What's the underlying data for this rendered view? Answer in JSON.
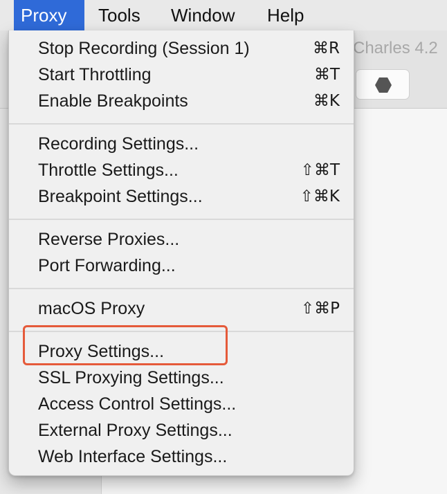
{
  "menubar": {
    "items": [
      {
        "label": "Proxy",
        "active": true
      },
      {
        "label": "Tools",
        "active": false
      },
      {
        "label": "Window",
        "active": false
      },
      {
        "label": "Help",
        "active": false
      }
    ]
  },
  "window": {
    "title": "Charles 4.2",
    "toolbar_icon": "stop-hexagon-icon"
  },
  "menu": {
    "groups": [
      [
        {
          "label": "Stop Recording (Session 1)",
          "shortcut": "⌘R"
        },
        {
          "label": "Start Throttling",
          "shortcut": "⌘T"
        },
        {
          "label": "Enable Breakpoints",
          "shortcut": "⌘K"
        }
      ],
      [
        {
          "label": "Recording Settings...",
          "shortcut": ""
        },
        {
          "label": "Throttle Settings...",
          "shortcut": "⇧⌘T"
        },
        {
          "label": "Breakpoint Settings...",
          "shortcut": "⇧⌘K"
        }
      ],
      [
        {
          "label": "Reverse Proxies...",
          "shortcut": ""
        },
        {
          "label": "Port Forwarding...",
          "shortcut": ""
        }
      ],
      [
        {
          "label": "macOS Proxy",
          "shortcut": "⇧⌘P"
        }
      ],
      [
        {
          "label": "Proxy Settings...",
          "shortcut": ""
        },
        {
          "label": "SSL Proxying Settings...",
          "shortcut": ""
        },
        {
          "label": "Access Control Settings...",
          "shortcut": ""
        },
        {
          "label": "External Proxy Settings...",
          "shortcut": ""
        },
        {
          "label": "Web Interface Settings...",
          "shortcut": ""
        }
      ]
    ]
  },
  "colors": {
    "menubar_active": "#2f6ad8",
    "highlight": "#e55a3a"
  }
}
